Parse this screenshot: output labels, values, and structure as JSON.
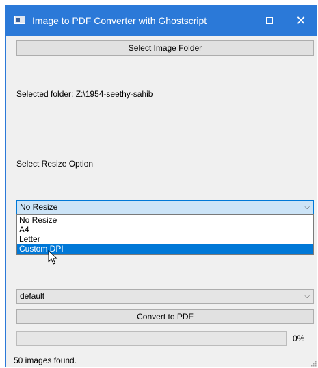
{
  "window": {
    "title": "Image to PDF Converter with Ghostscript",
    "controls": {
      "minimize": "",
      "maximize": "",
      "close": "✕"
    }
  },
  "select_folder_button": "Select Image Folder",
  "selected_folder_label": "Selected folder: Z:\\1954-seethy-sahib",
  "resize_label": "Select Resize Option",
  "resize_combo": {
    "value": "No Resize",
    "options": [
      "No Resize",
      "A4",
      "Letter",
      "Custom DPI"
    ],
    "highlighted": "Custom DPI"
  },
  "quality_combo": {
    "value": "default"
  },
  "convert_button": "Convert to PDF",
  "progress": {
    "value": 0,
    "label": "0%"
  },
  "status": "50 images found.",
  "colors": {
    "titlebar": "#2b79d8",
    "selection": "#0078d7",
    "focus": "#cce4f7"
  }
}
